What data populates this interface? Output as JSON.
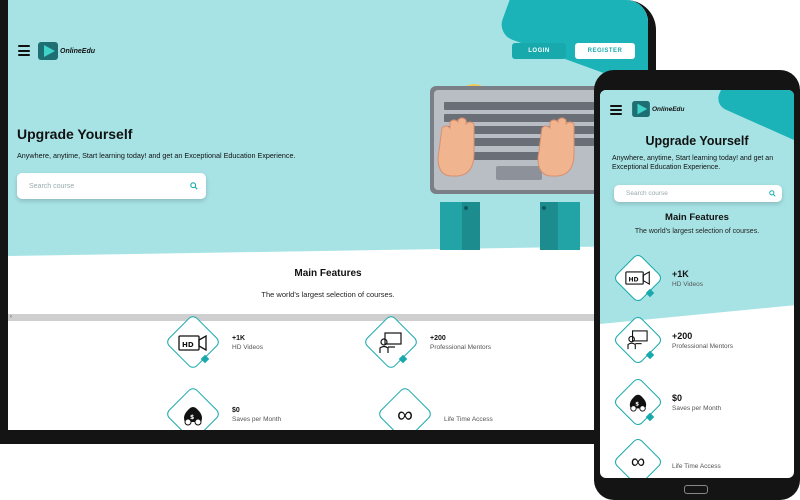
{
  "brand": {
    "name": "OnlineEdu",
    "accent": "#18a9ad",
    "hero_bg": "#a7e3e5"
  },
  "nav": {
    "login": "LOGIN",
    "register": "REGISTER",
    "menu_icon": "hamburger-menu-icon"
  },
  "hero": {
    "title": "Upgrade Yourself",
    "subtitle": "Anywhere, anytime, Start learning today! and get an Exceptional Education Experience.",
    "search_placeholder": "Search course",
    "search_icon": "search-icon"
  },
  "features_section": {
    "title": "Main Features",
    "subtitle": "The world's largest selection of courses."
  },
  "features": [
    {
      "value": "+1K",
      "label": "HD Videos",
      "icon": "hd-video-icon"
    },
    {
      "value": "+200",
      "label": "Professional Mentors",
      "icon": "mentor-icon"
    },
    {
      "value": "$0",
      "label": "Saves per Month",
      "icon": "money-bag-icon"
    },
    {
      "value": "",
      "label": "Life Time Access",
      "icon": "infinity-icon"
    }
  ]
}
